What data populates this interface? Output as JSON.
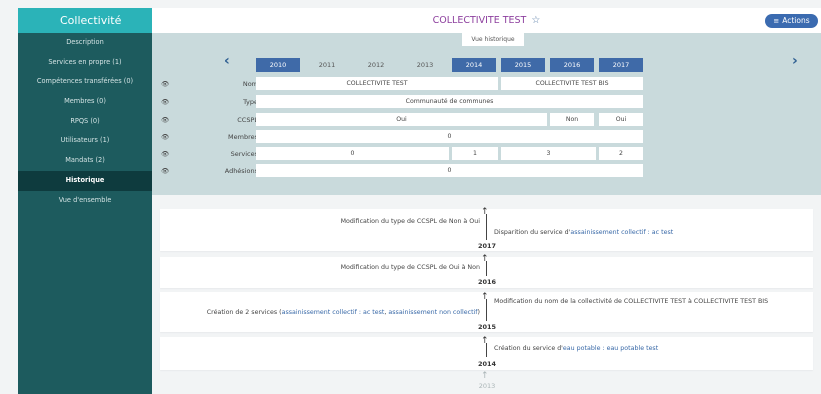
{
  "sidebar": {
    "header": "Collectivité",
    "items": [
      {
        "label": "Description"
      },
      {
        "label": "Services en propre (1)"
      },
      {
        "label": "Compétences transférées (0)"
      },
      {
        "label": "Membres (0)"
      },
      {
        "label": "RPQS (0)"
      },
      {
        "label": "Utilisateurs (1)"
      },
      {
        "label": "Mandats (2)"
      },
      {
        "label": "Historique"
      },
      {
        "label": "Vue d'ensemble"
      }
    ]
  },
  "header": {
    "title": "COLLECTIVITE TEST",
    "star": "☆",
    "actions": "Actions",
    "actions_icon": "≡"
  },
  "history": {
    "tab": "Vue historique",
    "prev": "‹",
    "next": "›",
    "years": [
      "2010",
      "2011",
      "2012",
      "2013",
      "2014",
      "2015",
      "2016",
      "2017"
    ],
    "eye": "👁",
    "rows": {
      "nom": {
        "label": "Nom",
        "v1": "COLLECTIVITE TEST",
        "v2": "COLLECTIVITE TEST BIS"
      },
      "type": {
        "label": "Type",
        "v1": "Communauté de communes"
      },
      "ccspl": {
        "label": "CCSPL",
        "v1": "Oui",
        "v2": "Non",
        "v3": "Oui"
      },
      "membres": {
        "label": "Membres",
        "v1": "0"
      },
      "services": {
        "label": "Services",
        "v1": "0",
        "v2": "1",
        "v3": "3",
        "v4": "2"
      },
      "adhesions": {
        "label": "Adhésions",
        "v1": "0"
      }
    }
  },
  "timeline": {
    "e2017": {
      "left": "Modification du type de CCSPL de Non à Oui",
      "right_pre": "Disparition du service d'",
      "right_link": "assainissement collectif : ac test",
      "year": "2017"
    },
    "e2016": {
      "left": "Modification du type de CCSPL de Oui à Non",
      "year": "2016"
    },
    "e2015": {
      "left_pre": "Création de 2 services (",
      "left_link1": "assainissement collectif : ac test",
      "left_sep": ", ",
      "left_link2": "assainissement non collectif",
      "left_post": ")",
      "right": "Modification du nom de la collectivité de COLLECTIVITE TEST à COLLECTIVITE TEST BIS",
      "year": "2015"
    },
    "e2014": {
      "right_pre": "Création du service d'",
      "right_link": "eau potable : eau potable test",
      "year": "2014"
    },
    "e2013": {
      "year": "2013"
    },
    "arrow": "↑"
  }
}
